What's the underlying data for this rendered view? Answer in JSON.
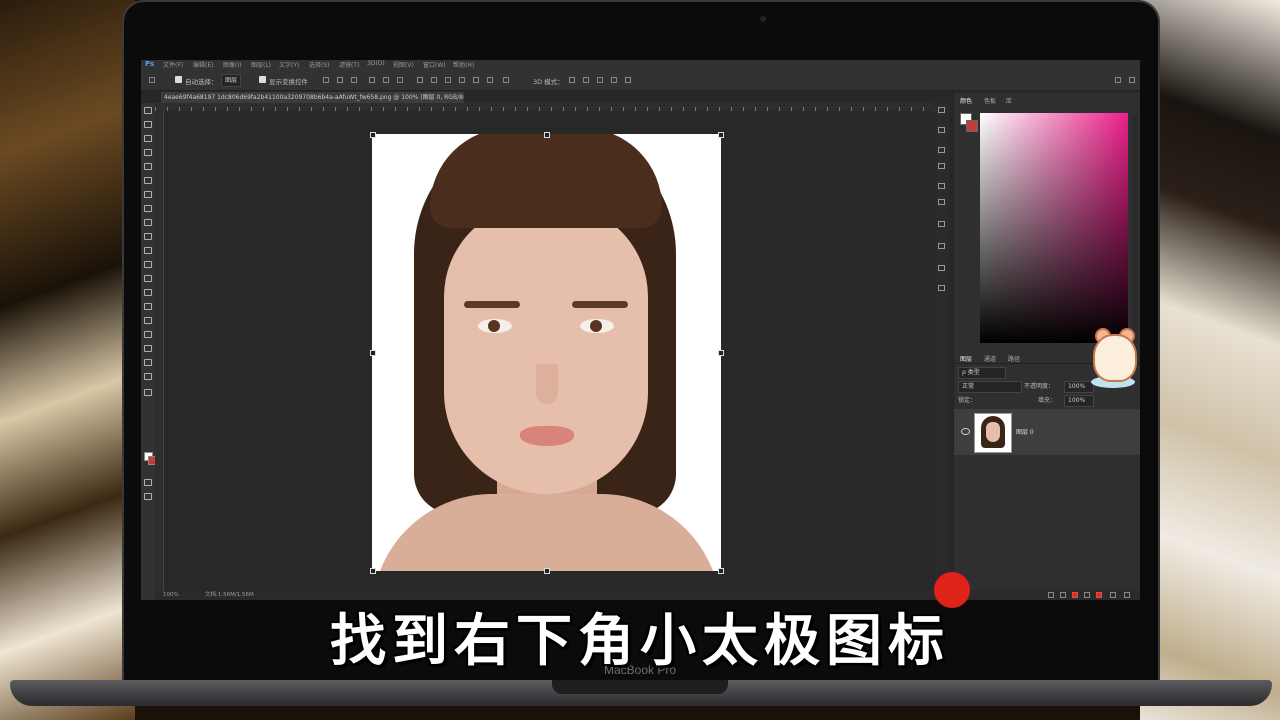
{
  "app": {
    "logo": "Ps",
    "menu": [
      "文件(F)",
      "编辑(E)",
      "图像(I)",
      "图层(L)",
      "文字(Y)",
      "选择(S)",
      "滤镜(T)",
      "3D(D)",
      "视图(V)",
      "窗口(W)",
      "帮助(H)"
    ]
  },
  "options_bar": {
    "auto_select_label": "自动选择：",
    "auto_select_value": "图层",
    "transform_label": "显示变换控件",
    "mode_3d": "3D 模式："
  },
  "document_tab": {
    "title": "4eae69f4a68197 1dc806d69fa2b41100a3209708b6b4a-aAfuWt_fw658.png @ 100% (图层 0, RGB/8#) *"
  },
  "status_bar": {
    "zoom": "100%",
    "doc_info": "文档:1.56M/1.56M"
  },
  "right_panel": {
    "color_tabs": [
      "颜色",
      "色板",
      "库"
    ],
    "layer_tabs": [
      "图层",
      "通道",
      "路径"
    ],
    "kind_filter": "ρ 类型",
    "blend_mode": "正常",
    "opacity_label": "不透明度：",
    "opacity_value": "100%",
    "lock_label": "锁定：",
    "fill_label": "填充：",
    "fill_value": "100%",
    "layer_name": "图层 0"
  },
  "colors": {
    "foreground": "#ffffff",
    "background": "#c43c3c",
    "picker_hue": "#ec1f8a"
  },
  "subtitle": "找到右下角小太极图标",
  "laptop_brand": "MacBook Pro"
}
